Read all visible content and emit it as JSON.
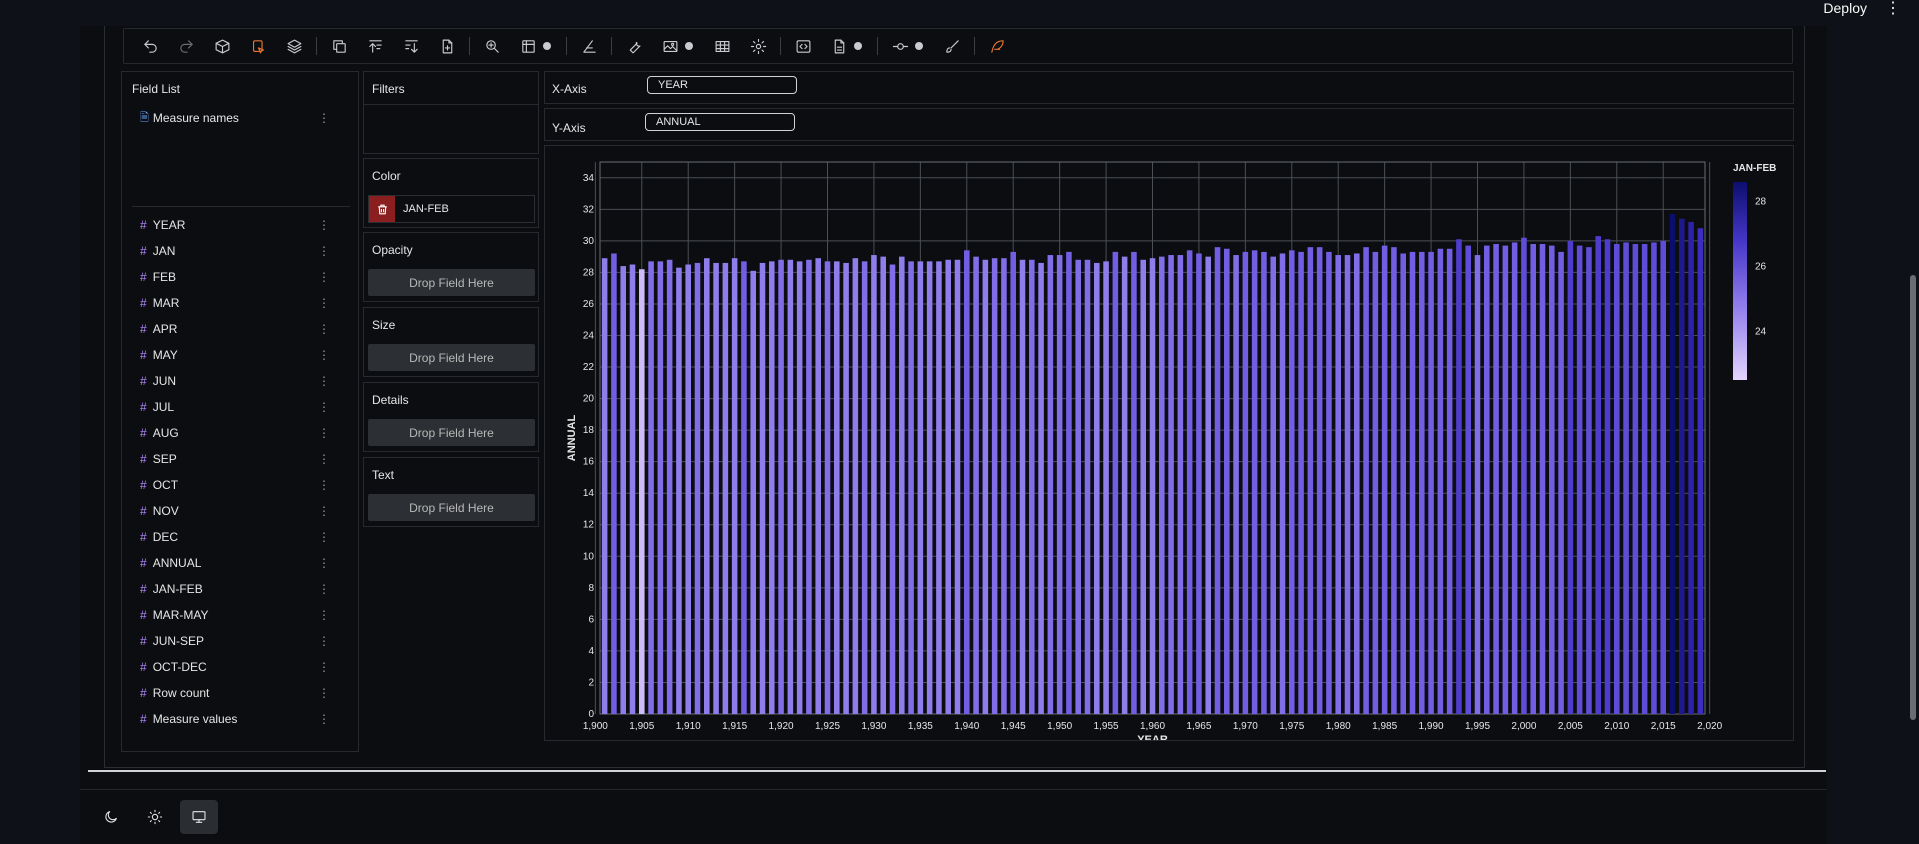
{
  "header": {
    "deploy_label": "Deploy",
    "menu_icon": "kebab-menu-icon"
  },
  "toolbar": {
    "icons": [
      "undo-icon",
      "redo-icon",
      "cube-icon",
      "select-icon",
      "layers-icon",
      "copy-icon",
      "sort-asc-icon",
      "sort-desc-icon",
      "add-file-icon",
      "zoom-icon",
      "scale-icon",
      "gear-icon",
      "brush-icon",
      "wrench-icon",
      "image-icon",
      "gear-icon",
      "table-icon",
      "settings-icon",
      "code-icon",
      "file-icon",
      "gear-icon",
      "commit-icon",
      "gear-icon",
      "paint-brush-icon",
      "feather-icon"
    ]
  },
  "field_list": {
    "title": "Field List",
    "measure_names": "Measure names",
    "fields": [
      "YEAR",
      "JAN",
      "FEB",
      "MAR",
      "APR",
      "MAY",
      "JUN",
      "JUL",
      "AUG",
      "SEP",
      "OCT",
      "NOV",
      "DEC",
      "ANNUAL",
      "JAN-FEB",
      "MAR-MAY",
      "JUN-SEP",
      "OCT-DEC",
      "Row count",
      "Measure values"
    ]
  },
  "encodings": {
    "filters_title": "Filters",
    "color_title": "Color",
    "color_field": "JAN-FEB",
    "opacity_title": "Opacity",
    "size_title": "Size",
    "details_title": "Details",
    "text_title": "Text",
    "drop_label": "Drop Field Here"
  },
  "axes": {
    "x_label": "X-Axis",
    "x_field": "YEAR",
    "y_label": "Y-Axis",
    "y_field": "ANNUAL"
  },
  "chart_data": {
    "type": "bar",
    "xlabel": "YEAR",
    "ylabel": "ANNUAL",
    "ylim": [
      0,
      35
    ],
    "y_ticks": [
      0,
      2,
      4,
      6,
      8,
      10,
      12,
      14,
      16,
      18,
      20,
      22,
      24,
      26,
      28,
      30,
      32,
      34
    ],
    "x_ticks": [
      "1,900",
      "1,905",
      "1,910",
      "1,915",
      "1,920",
      "1,925",
      "1,930",
      "1,935",
      "1,940",
      "1,945",
      "1,950",
      "1,955",
      "1,960",
      "1,965",
      "1,970",
      "1,975",
      "1,980",
      "1,985",
      "1,990",
      "1,995",
      "2,000",
      "2,005",
      "2,010",
      "2,015",
      "2,020"
    ],
    "grid": true,
    "x_start": 1901,
    "legend": {
      "title": "JAN-FEB",
      "ticks": [
        "28",
        "26",
        "24"
      ],
      "min": 22.5,
      "max": 28.6,
      "position": "right"
    },
    "values": [
      28.9,
      29.2,
      28.4,
      28.5,
      28.2,
      28.7,
      28.7,
      28.8,
      28.3,
      28.5,
      28.6,
      28.9,
      28.6,
      28.6,
      28.9,
      28.7,
      28.1,
      28.6,
      28.7,
      28.8,
      28.8,
      28.7,
      28.8,
      28.9,
      28.7,
      28.7,
      28.6,
      28.9,
      28.7,
      29.1,
      29.0,
      28.5,
      29.0,
      28.7,
      28.7,
      28.7,
      28.7,
      28.8,
      28.8,
      29.4,
      29.0,
      28.8,
      28.9,
      28.9,
      29.3,
      28.8,
      28.8,
      28.6,
      29.1,
      29.1,
      29.3,
      28.8,
      28.8,
      28.6,
      28.7,
      29.3,
      29.0,
      29.3,
      28.8,
      28.9,
      29.0,
      29.1,
      29.1,
      29.4,
      29.2,
      29.0,
      29.6,
      29.5,
      29.1,
      29.3,
      29.4,
      29.3,
      29.0,
      29.2,
      29.4,
      29.3,
      29.6,
      29.6,
      29.3,
      29.1,
      29.1,
      29.2,
      29.6,
      29.3,
      29.7,
      29.6,
      29.2,
      29.3,
      29.3,
      29.3,
      29.5,
      29.5,
      30.1,
      29.7,
      29.1,
      29.7,
      29.8,
      29.7,
      29.9,
      30.2,
      29.8,
      29.8,
      29.7,
      29.3,
      30.0,
      29.7,
      29.6,
      30.3,
      30.1,
      29.8,
      29.9,
      29.8,
      29.8,
      29.9,
      30.0,
      31.7,
      31.4,
      31.2,
      30.8
    ],
    "colors": [
      24.5,
      25.5,
      24.5,
      24.5,
      23.0,
      25.0,
      25.0,
      25.0,
      24.5,
      24.5,
      25.0,
      24.5,
      24.5,
      24.5,
      24.5,
      25.5,
      24.5,
      24.5,
      24.5,
      25.0,
      24.5,
      24.5,
      25.0,
      24.5,
      25.0,
      24.5,
      24.5,
      24.5,
      25.0,
      24.5,
      24.5,
      25.0,
      24.5,
      25.0,
      24.5,
      24.5,
      24.5,
      24.5,
      24.5,
      25.5,
      25.0,
      24.5,
      25.0,
      25.0,
      25.5,
      24.5,
      25.0,
      24.5,
      25.0,
      25.0,
      25.5,
      25.0,
      25.0,
      24.5,
      24.5,
      25.5,
      24.5,
      25.5,
      24.5,
      24.5,
      25.0,
      25.0,
      25.0,
      25.5,
      25.5,
      24.5,
      25.5,
      25.5,
      25.0,
      25.5,
      25.5,
      25.5,
      25.0,
      25.0,
      25.5,
      25.5,
      25.5,
      25.5,
      25.5,
      25.0,
      25.0,
      25.0,
      25.5,
      25.5,
      25.5,
      25.5,
      25.5,
      25.5,
      25.5,
      25.5,
      25.5,
      25.5,
      26.5,
      26.0,
      25.0,
      25.5,
      25.5,
      25.5,
      25.5,
      26.0,
      25.5,
      25.5,
      25.5,
      25.5,
      26.5,
      26.0,
      26.0,
      26.5,
      26.5,
      26.0,
      26.0,
      26.0,
      26.0,
      26.0,
      26.0,
      28.6,
      28.0,
      27.5,
      27.0
    ]
  }
}
